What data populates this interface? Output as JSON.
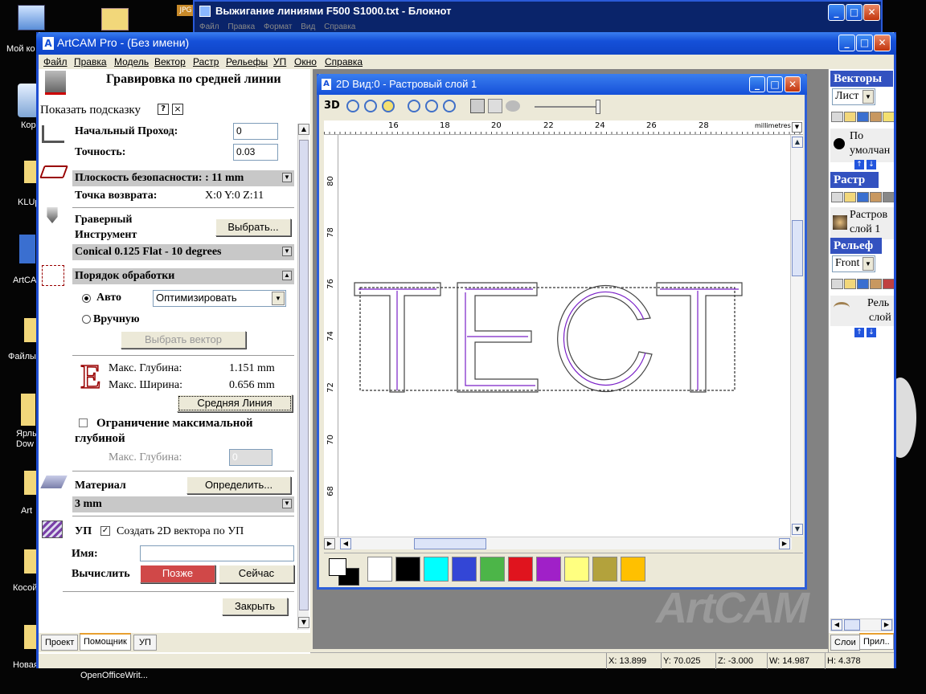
{
  "desktop": {
    "labels": [
      "Мой ко",
      "Кор",
      "KLUp",
      "ArtCA",
      "Файлы",
      "Ярлы",
      "Dow",
      "Art",
      "Косой",
      "Новая"
    ],
    "taskbar_item": "OpenOfficeWrit..."
  },
  "notepad": {
    "title": "Выжигание линиями F500 S1000.txt - Блокнот",
    "menu": [
      "Файл",
      "Правка",
      "Формат",
      "Вид",
      "Справка"
    ]
  },
  "app": {
    "title": "ArtCAM Pro - (Без имени)",
    "menu": [
      "Файл",
      "Правка",
      "Модель",
      "Вектор",
      "Растр",
      "Рельефы",
      "УП",
      "Окно",
      "Справка"
    ],
    "status": {
      "x": "X: 13.899",
      "y": "Y: 70.025",
      "z": "Z: -3.000",
      "w": "W: 14.987",
      "h": "H: 4.378"
    }
  },
  "panel": {
    "title": "Гравировка по средней линии",
    "hint": "Показать подсказку",
    "hint_q": "?",
    "hint_x": "×",
    "start_pass_label": "Начальный Проход:",
    "start_pass_value": "0",
    "accuracy_label": "Точность:",
    "accuracy_value": "0.03",
    "safe_plane": "Плоскость безопасности: : 11 mm",
    "return_point_label": "Точка возврата:",
    "return_point_value": "X:0 Y:0 Z:11",
    "tool_label_1": "Граверный",
    "tool_label_2": "Инструмент",
    "select_btn": "Выбрать...",
    "tool_name": "Conical 0.125 Flat - 10 degrees",
    "order_title": "Порядок обработки",
    "auto_label": "Авто",
    "order_option": "Оптимизировать",
    "manual_label": "Вручную",
    "select_vector_btn": "Выбрать вектор",
    "max_depth_label": "Макс. Глубина:",
    "max_depth_value": "1.151 mm",
    "max_width_label": "Макс. Ширина:",
    "max_width_value": "0.656 mm",
    "centerline_btn": "Средняя Линия",
    "limit_label_1": "Ограничение максимальной",
    "limit_label_2": "глубиной",
    "limit_depth_label": "Макс. Глубина:",
    "limit_depth_value": "0",
    "material_label": "Материал",
    "define_btn": "Определить...",
    "material_value": "3 mm",
    "up_label": "УП",
    "create_vectors": "Создать 2D вектора по УП",
    "name_label": "Имя:",
    "name_value": "",
    "compute_label": "Вычислить",
    "later_btn": "Позже",
    "now_btn": "Сейчас",
    "close_btn": "Закрыть",
    "tabs": [
      "Проект",
      "Помощник",
      "УП"
    ]
  },
  "view": {
    "title": "2D Вид:0 - Растровый слой 1",
    "btn_3d": "3D",
    "ruler_unit": "millimetres",
    "x_ticks": [
      "16",
      "18",
      "20",
      "22",
      "24",
      "26",
      "28"
    ],
    "y_ticks": [
      "80",
      "78",
      "76",
      "74",
      "72",
      "70",
      "68"
    ],
    "text": "ТЕСТ",
    "palette": [
      "#ffffff",
      "#000000",
      "#00ffff",
      "#3346d6",
      "#4cb548",
      "#e0141e",
      "#a020c8",
      "#ffff80",
      "#b3a23c",
      "#ffc000"
    ]
  },
  "right": {
    "vectors_title": "Векторы",
    "vectors_select": "Лист",
    "default_label_1": "По",
    "default_label_2": "умолчан",
    "raster_title": "Растр",
    "raster_layer_1": "Растров",
    "raster_layer_2": "слой 1",
    "relief_title": "Рельеф",
    "relief_select": "Front",
    "relief_item_1": "Рель",
    "relief_item_2": "слой",
    "tabs": [
      "Слои",
      "Прил.."
    ]
  },
  "watermark": "ArtCAM"
}
